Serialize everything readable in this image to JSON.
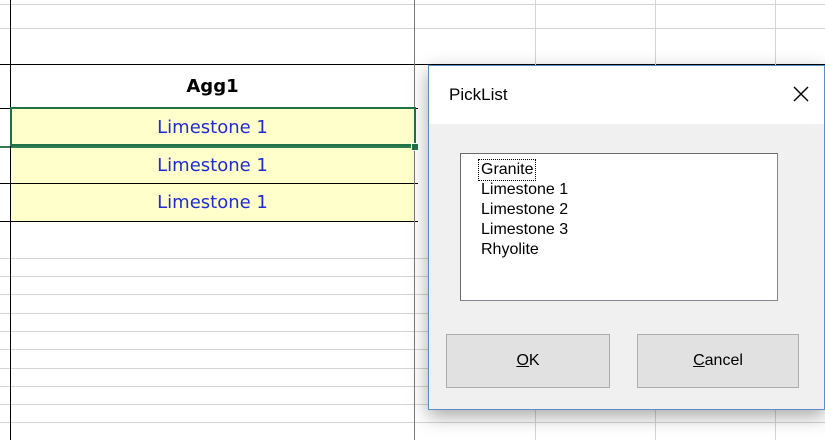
{
  "spreadsheet": {
    "column_header": "Agg1",
    "rows": [
      {
        "value": "Limestone 1"
      },
      {
        "value": "Limestone 1"
      },
      {
        "value": "Limestone 1"
      }
    ],
    "highlight_color": "#ffffcc",
    "text_color": "#1f2bd6"
  },
  "dialog": {
    "title": "PickList",
    "close_icon": "close-icon",
    "list": {
      "items": [
        "Granite",
        "Limestone 1",
        "Limestone 2",
        "Limestone 3",
        "Rhyolite"
      ],
      "focused_item": "Granite"
    },
    "ok_button": {
      "mnemonic": "O",
      "rest": "K"
    },
    "cancel_button": {
      "mnemonic": "C",
      "rest": "ancel"
    }
  }
}
